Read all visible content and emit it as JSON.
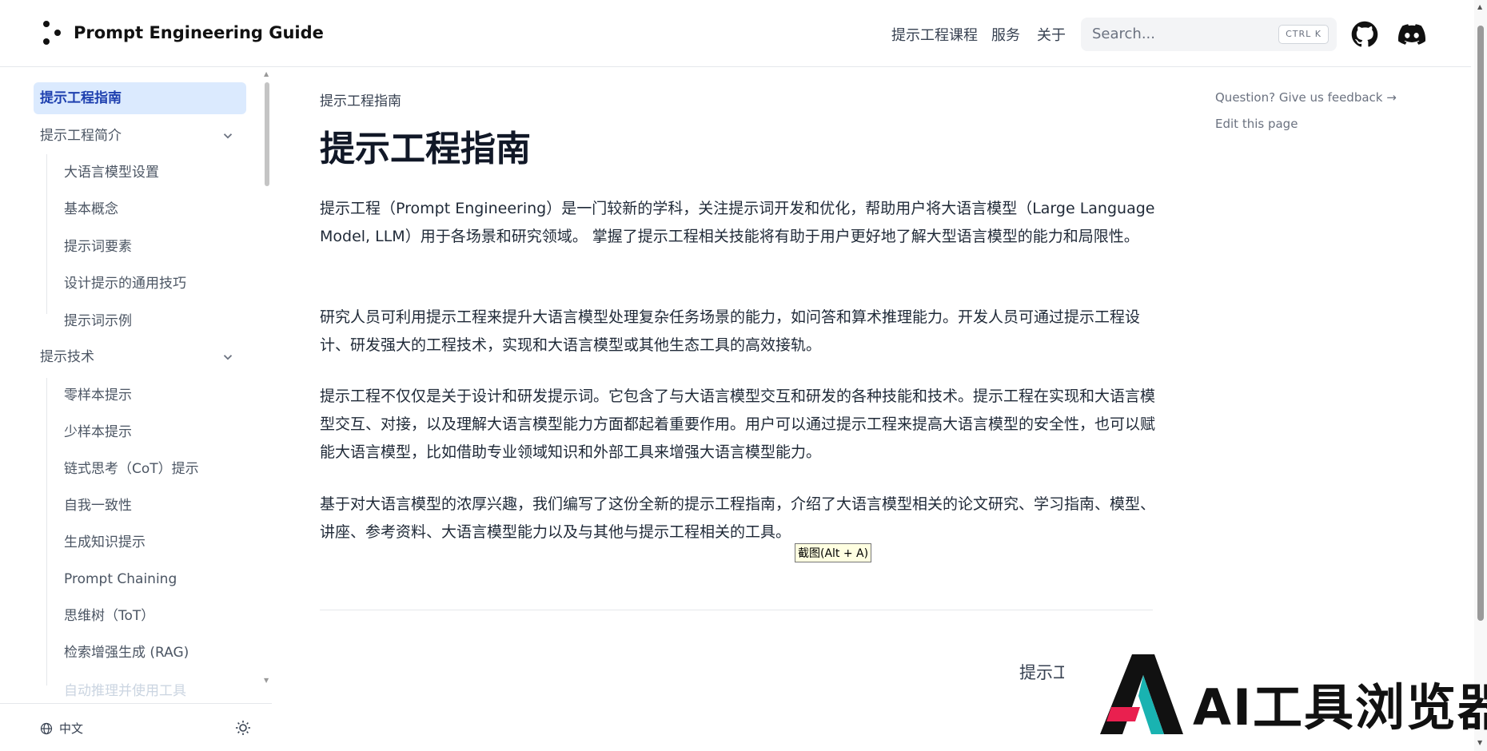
{
  "header": {
    "logo_text": "Prompt Engineering Guide",
    "nav": [
      "提示工程课程",
      "服务",
      "关于"
    ],
    "search": {
      "placeholder": "Search...",
      "shortcut": "CTRL K"
    },
    "github_icon": "github-icon",
    "discord_icon": "discord-icon"
  },
  "sidebar": {
    "active": "提示工程指南",
    "sections": [
      {
        "label": "提示工程简介",
        "items": [
          "大语言模型设置",
          "基本概念",
          "提示词要素",
          "设计提示的通用技巧",
          "提示词示例"
        ]
      },
      {
        "label": "提示技术",
        "items": [
          "零样本提示",
          "少样本提示",
          "链式思考（CoT）提示",
          "自我一致性",
          "生成知识提示",
          "Prompt Chaining",
          "思维树（ToT）",
          "检索增强生成 (RAG)",
          "自动推理并使用工具"
        ]
      }
    ],
    "footer": {
      "language": "中文"
    }
  },
  "main": {
    "breadcrumb": "提示工程指南",
    "title": "提示工程指南",
    "paragraphs": [
      "提示工程（Prompt Engineering）是一门较新的学科，关注提示词开发和优化，帮助用户将大语言模型（Large Language Model, LLM）用于各场景和研究领域。 掌握了提示工程相关技能将有助于用户更好地了解大型语言模型的能力和局限性。",
      "研究人员可利用提示工程来提升大语言模型处理复杂任务场景的能力，如问答和算术推理能力。开发人员可通过提示工程设计、研发强大的工程技术，实现和大语言模型或其他生态工具的高效接轨。",
      "提示工程不仅仅是关于设计和研发提示词。它包含了与大语言模型交互和研发的各种技能和技术。提示工程在实现和大语言模型交互、对接，以及理解大语言模型能力方面都起着重要作用。用户可以通过提示工程来提高大语言模型的安全性，也可以赋能大语言模型，比如借助专业领域知识和外部工具来增强大语言模型能力。",
      "基于对大语言模型的浓厚兴趣，我们编写了这份全新的提示工程指南，介绍了大语言模型相关的论文研究、学习指南、模型、讲座、参考资料、大语言模型能力以及与其他与提示工程相关的工具。"
    ],
    "tooltip": "截图(Alt + A)",
    "next_link": "提示工程简介"
  },
  "toc": {
    "feedback": "Question? Give us feedback →",
    "edit": "Edit this page"
  },
  "watermark": {
    "text": "AI工具浏览器"
  }
}
